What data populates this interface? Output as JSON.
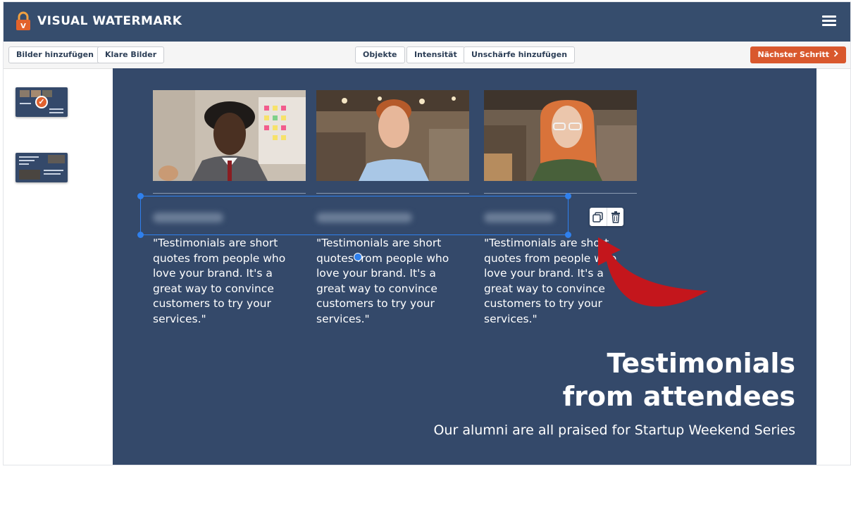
{
  "app": {
    "title": "VISUAL WATERMARK",
    "logo_icon": "padlock-logo-icon",
    "menu_icon": "hamburger-menu-icon"
  },
  "toolbar": {
    "add_images": "Bilder hinzufügen",
    "clear_images": "Klare Bilder",
    "objects": "Objekte",
    "intensity": "Intensität",
    "add_blur": "Unschärfe hinzufügen",
    "next_step": "Nächster Schritt",
    "next_icon": "chevron-right-icon"
  },
  "sidebar": {
    "thumbnails": [
      {
        "state": "selected",
        "icon": "check-icon"
      },
      {
        "state": "unselected"
      }
    ]
  },
  "slide": {
    "quotes": [
      "\"Testimonials are short quotes from people who love your brand. It's a great way to convince customers to try your services.\"",
      "\"Testimonials are short quotes from people who love your brand. It's a great way to convince customers to try your services.\"",
      "\"Testimonials are short quotes from people who love your brand. It's a great way to convince customers to try your services.\""
    ],
    "heading_line1": "Testimonials",
    "heading_line2": "from attendees",
    "subheading": "Our alumni are all praised for Startup Weekend Series"
  },
  "selection_tools": {
    "duplicate_icon": "duplicate-icon",
    "delete_icon": "trash-icon"
  },
  "colors": {
    "header_bg": "#364d6d",
    "canvas_bg": "#34496a",
    "accent_orange": "#d9582d",
    "selection_blue": "#2f80ed",
    "annotation_red": "#c4161c"
  }
}
